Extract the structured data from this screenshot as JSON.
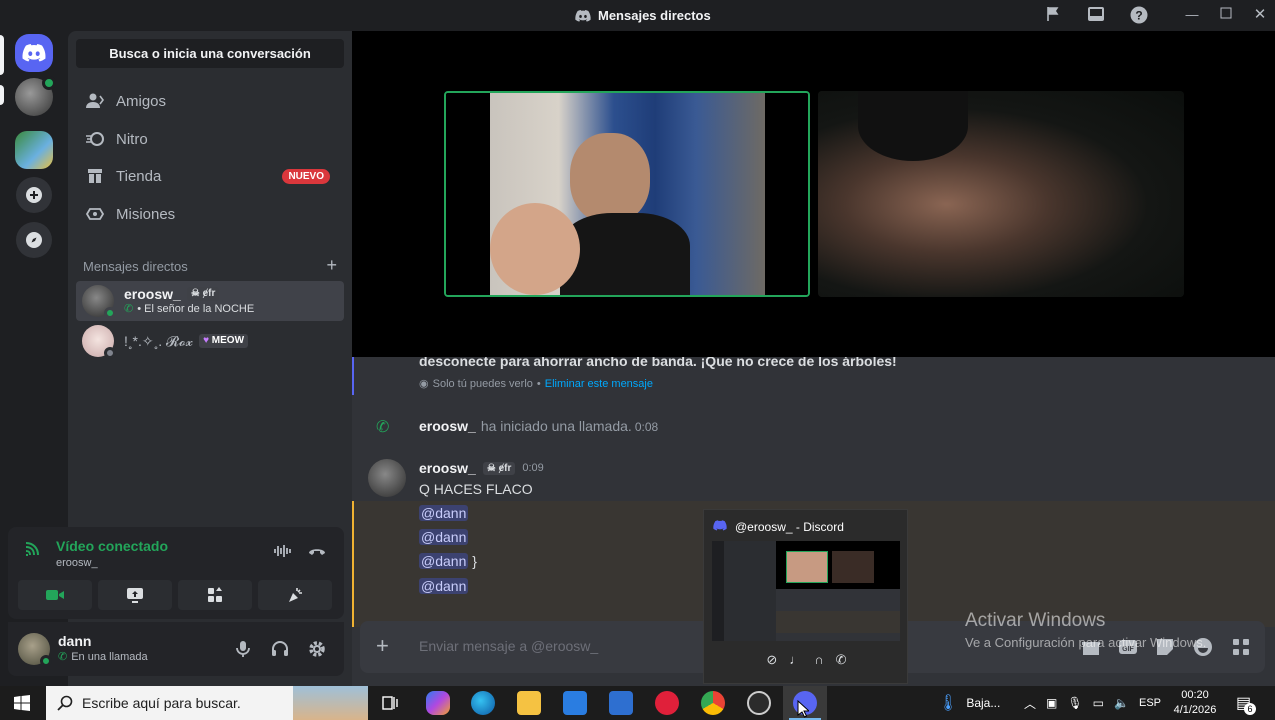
{
  "window": {
    "title": "Mensajes directos"
  },
  "sidebar": {
    "search_label": "Busca o inicia una conversación",
    "nav": [
      {
        "label": "Amigos",
        "icon": "friends-icon"
      },
      {
        "label": "Nitro",
        "icon": "nitro-icon"
      },
      {
        "label": "Tienda",
        "icon": "shop-icon",
        "badge": "NUEVO"
      },
      {
        "label": "Misiones",
        "icon": "quests-icon"
      }
    ],
    "dm_header": "Mensajes directos",
    "dms": [
      {
        "name": "eroosw_",
        "tag": "ɇfr",
        "sub": "• El señor de la NOCHE",
        "status": "online"
      },
      {
        "name": "!˳*.✧˳. 𝓡𝓸𝔁",
        "tag": "MEOW",
        "sub": "",
        "status": "offline"
      }
    ]
  },
  "voice": {
    "title": "Vídeo conectado",
    "sub": "eroosw_"
  },
  "user": {
    "name": "dann",
    "status": "En una llamada"
  },
  "messages": {
    "system_text": "desconecte para ahorrar ancho de banda. ¡Que no crece de los árboles!",
    "ephemeral_note": "Solo tú puedes verlo",
    "ephemeral_sep": "•",
    "ephemeral_action": "Eliminar este mensaje",
    "call_user": "eroosw_",
    "call_text": "ha iniciado una llamada.",
    "call_duration": "0:08",
    "author": "eroosw_",
    "author_tag": "ɇfr",
    "time": "0:09",
    "line1": "Q HACES FLACO",
    "mention": "@dann",
    "brace": "}"
  },
  "input": {
    "placeholder": "Enviar mensaje a @eroosw_"
  },
  "preview": {
    "title": "@eroosw_ - Discord"
  },
  "watermark": {
    "line1": "Activar Windows",
    "line2": "Ve a Configuración para activar Windows."
  },
  "taskbar": {
    "search_placeholder": "Escribe aquí para buscar.",
    "weather": "Baja...",
    "lang": "ESP",
    "time": "00:20",
    "date": "4/1/2026",
    "notif_count": "6"
  }
}
